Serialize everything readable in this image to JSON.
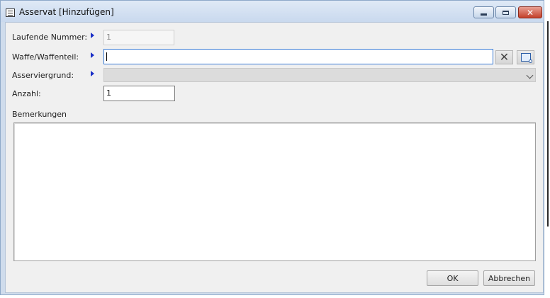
{
  "window": {
    "title": "Asservat [Hinzufügen]",
    "close_glyph": "✕"
  },
  "form": {
    "laufende_nummer": {
      "label": "Laufende Nummer:",
      "value": "1"
    },
    "waffe": {
      "label": "Waffe/Waffenteil:",
      "value": ""
    },
    "asserviergrund": {
      "label": "Asserviergrund:",
      "value": ""
    },
    "anzahl": {
      "label": "Anzahl:",
      "value": "1"
    },
    "bemerkungen": {
      "label": "Bemerkungen",
      "value": ""
    }
  },
  "buttons": {
    "clear_glyph": "✕",
    "ok": "OK",
    "cancel": "Abbrechen"
  },
  "colors": {
    "title_bar": "#cfdcec",
    "client_bg": "#f0f0f0",
    "required_arrow": "#1a2fc7",
    "close_button": "#c3402b"
  },
  "icons": {
    "window_icon": "form-icon",
    "required": "arrow-right-icon",
    "clear": "close-icon",
    "lookup": "search-window-icon",
    "dropdown": "chevron-down-icon"
  }
}
